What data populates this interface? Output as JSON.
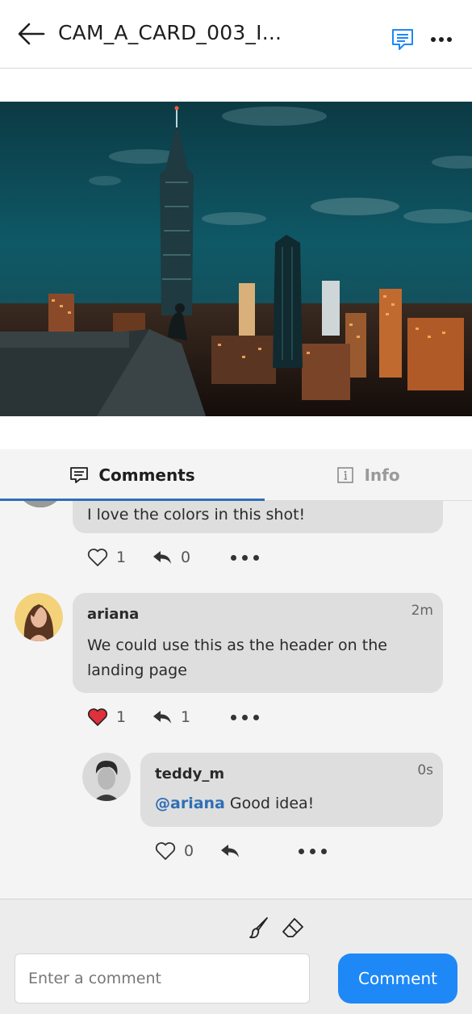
{
  "header": {
    "title": "CAM_A_CARD_003_I...",
    "back_icon": "arrow-left-icon",
    "comments_icon": "message-square-icon",
    "more_icon": "more-horizontal-icon",
    "accent_color": "#1e88f7"
  },
  "tabs": [
    {
      "label": "Comments",
      "icon": "message-square-icon",
      "active": true
    },
    {
      "label": "Info",
      "icon": "info-icon",
      "active": false
    }
  ],
  "comments": [
    {
      "author": "",
      "text": "I love the colors in this shot!",
      "likes": "1",
      "liked": false,
      "replies": "0"
    },
    {
      "author": "ariana",
      "time": "2m",
      "text": "We could use this as the header on the landing page",
      "likes": "1",
      "liked": true,
      "replies": "1",
      "reply": {
        "author": "teddy_m",
        "time": "0s",
        "mention": "@ariana",
        "text": " Good idea!",
        "likes": "0",
        "liked": false
      }
    }
  ],
  "composer": {
    "placeholder": "Enter a comment",
    "value": "",
    "submit_label": "Comment",
    "tools": [
      "brush-icon",
      "eraser-icon"
    ]
  },
  "colors": {
    "accent": "#1e88f7",
    "mention": "#2f6fb5",
    "liked_heart": "#e0303b",
    "bubble": "#dedede"
  }
}
